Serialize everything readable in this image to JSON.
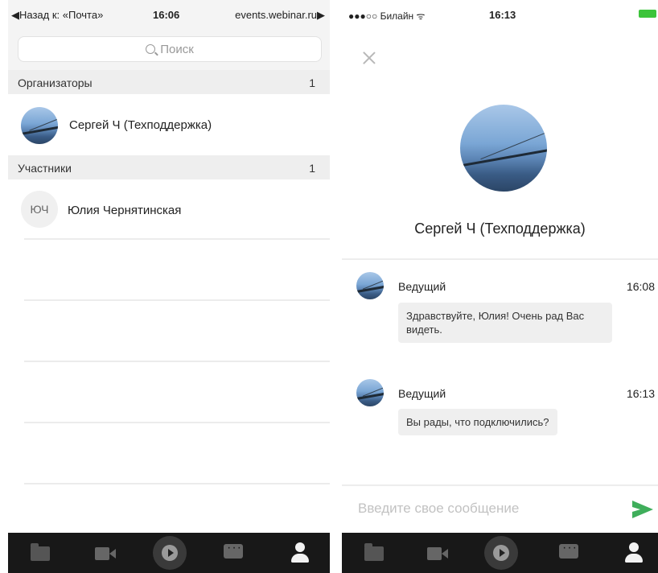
{
  "left": {
    "status": {
      "back": "◀Назад к: «Почта»",
      "time": "16:06",
      "url": "events.webinar.ru▶"
    },
    "search": {
      "placeholder": "Поиск"
    },
    "sections": [
      {
        "label": "Организаторы",
        "count": "1"
      },
      {
        "label": "Участники",
        "count": "1"
      }
    ],
    "organizers": [
      {
        "name": "Сергей Ч (Техподдержка)"
      }
    ],
    "participants": [
      {
        "initials": "ЮЧ",
        "name": "Юлия Чернятинская"
      }
    ]
  },
  "right": {
    "status": {
      "carrier": "●●●○○ Билайн ᯤ",
      "time": "16:13",
      "battery_color": "#3cc43a"
    },
    "profile_name": "Сергей Ч (Техподдержка)",
    "messages": [
      {
        "author": "Ведущий",
        "time": "16:08",
        "text": "Здравствуйте, Юлия! Очень рад Вас видеть."
      },
      {
        "author": "Ведущий",
        "time": "16:13",
        "text": "Вы рады, что подключились?"
      }
    ],
    "composer_placeholder": "Введите свое сообщение",
    "send_color": "#3fae5b"
  },
  "tabbar": {
    "icons": [
      "folder-icon",
      "video-icon",
      "play-icon",
      "chat-icon",
      "user-icon"
    ],
    "background": "#181818"
  }
}
